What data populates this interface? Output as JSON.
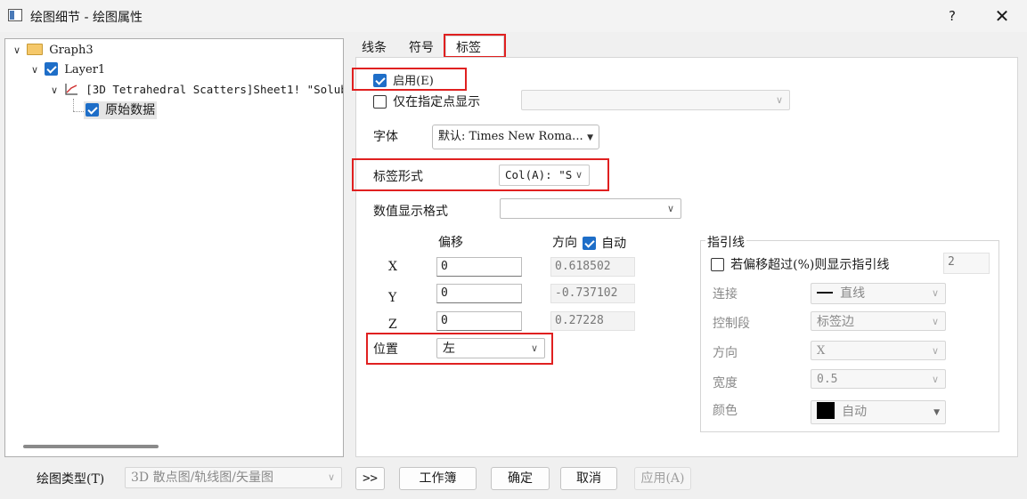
{
  "window": {
    "title": "绘图细节 - 绘图属性",
    "help_label": "?",
    "close_label": "✕"
  },
  "tree": {
    "graph": "Graph3",
    "layer": "Layer1",
    "plot": "[3D Tetrahedral Scatters]Sheet1! \"Solubi",
    "original_data": "原始数据"
  },
  "tabs": [
    "线条",
    "符号",
    "标签"
  ],
  "labels_tab": {
    "enable": "启用(E)",
    "enable_checked": true,
    "show_specified": "仅在指定点显示",
    "show_specified_checked": false,
    "font_label": "字体",
    "font_value": "默认: Times New Roma...",
    "label_form_label": "标签形式",
    "label_form_value": "Col(A): \"S",
    "number_format_label": "数值显示格式",
    "number_format_value": "",
    "offset_header": "偏移",
    "direction_header": "方向",
    "auto_label": "自动",
    "auto_checked": true,
    "rows": [
      {
        "axis": "X",
        "offset": "0",
        "direction": "0.618502"
      },
      {
        "axis": "Y",
        "offset": "0",
        "direction": "-0.737102"
      },
      {
        "axis": "Z",
        "offset": "0",
        "direction": "0.27228"
      }
    ],
    "position_label": "位置",
    "position_value": "左"
  },
  "leader": {
    "group_title": "指引线",
    "show_if_label": "若偏移超过(%)则显示指引线",
    "show_if_checked": false,
    "threshold": "2",
    "connect_label": "连接",
    "connect_value": "直线",
    "control_label": "控制段",
    "control_value": "标签边",
    "direction_label": "方向",
    "direction_value": "X",
    "width_label": "宽度",
    "width_value": "0.5",
    "color_label": "颜色",
    "color_value": "自动",
    "color_swatch": "#000000"
  },
  "bottom": {
    "plot_type_label": "绘图类型(T)",
    "plot_type_value": "3D 散点图/轨线图/矢量图",
    "expand_label": ">>",
    "workbook_label": "工作簿",
    "ok_label": "确定",
    "cancel_label": "取消",
    "apply_label": "应用(A)"
  },
  "colors": {
    "highlight_red": "#e02020",
    "checkbox_blue": "#1e6ec8"
  }
}
